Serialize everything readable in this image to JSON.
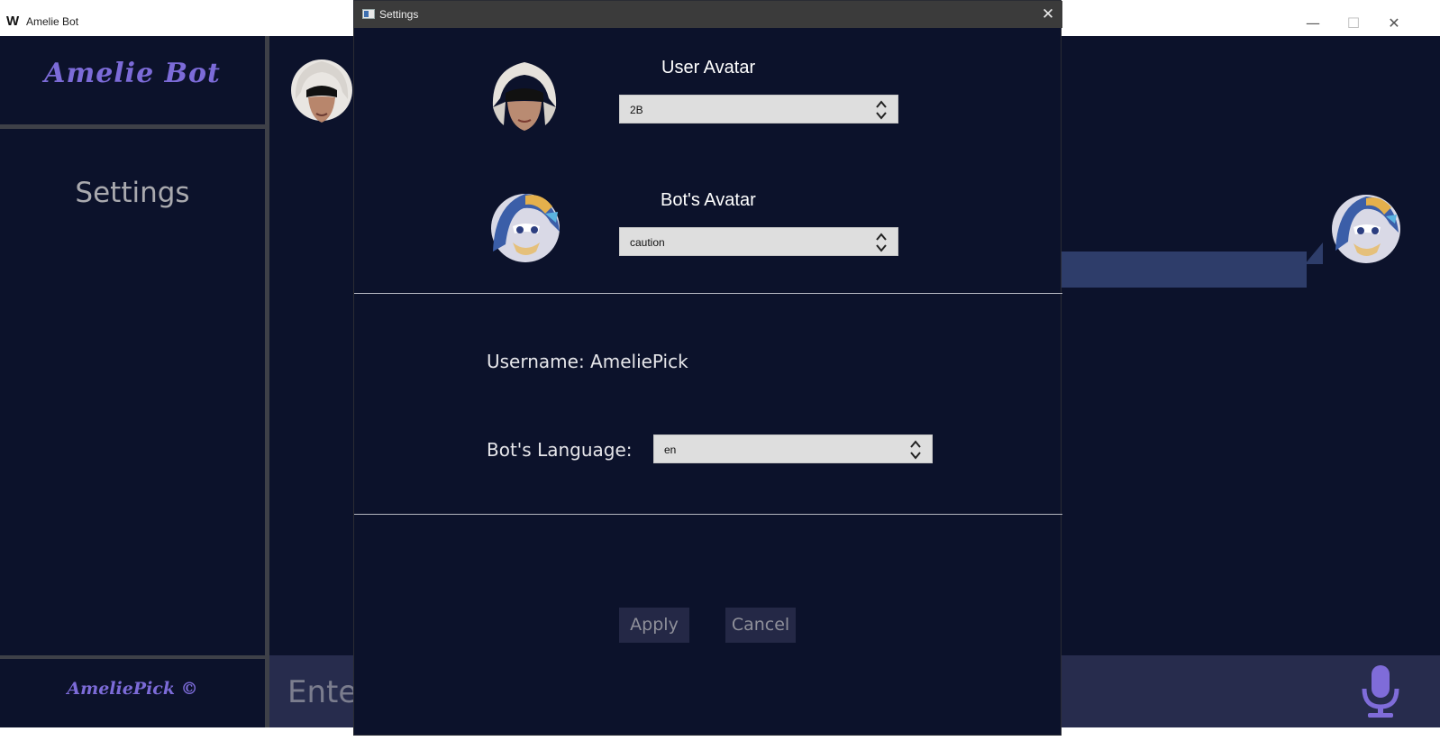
{
  "window": {
    "logo": "W",
    "title": "Amelie Bot",
    "minimize": "—",
    "maximize": "☐",
    "close": "✕"
  },
  "sidebar": {
    "brand": "Amelie Bot",
    "settings_label": "Settings",
    "footer_brand": "AmeliePick ©"
  },
  "chat": {
    "input_placeholder": "Ente"
  },
  "dialog": {
    "title": "Settings",
    "close": "✕",
    "user_avatar_label": "User Avatar",
    "user_avatar_value": "2B",
    "bot_avatar_label": "Bot's Avatar",
    "bot_avatar_value": "caution",
    "username_text": "Username:  AmeliePick",
    "language_label": "Bot's Language:",
    "language_value": "en",
    "apply_label": "Apply",
    "cancel_label": "Cancel"
  },
  "colors": {
    "background": "#0c122b",
    "accent": "#7c6bd8",
    "divider": "#3e4048",
    "button": "#242846",
    "input_bar": "#272c4d"
  },
  "icons": [
    "window-logo-icon",
    "minimize-icon",
    "maximize-icon",
    "close-icon",
    "settings-window-icon",
    "up-down-arrows-icon",
    "microphone-icon"
  ]
}
